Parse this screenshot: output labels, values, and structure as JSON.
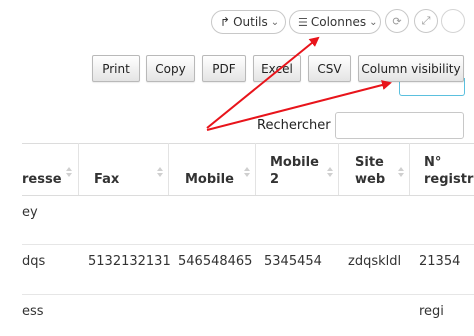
{
  "toolbar": {
    "outils_label": "Outils",
    "outils_caret": "⌄",
    "colonnes_label": "Colonnes",
    "colonnes_caret": "⌄"
  },
  "buttons": {
    "print": "Print",
    "copy": "Copy",
    "pdf": "PDF",
    "excel": "Excel",
    "csv": "CSV",
    "column_visibility": "Column visibility"
  },
  "search": {
    "label": "Rechercher :",
    "value": ""
  },
  "table": {
    "headers": [
      {
        "line1": "resse",
        "line2": ""
      },
      {
        "line1": "Fax",
        "line2": ""
      },
      {
        "line1": "Mobile",
        "line2": ""
      },
      {
        "line1": "Mobile",
        "line2": "2"
      },
      {
        "line1": "Site",
        "line2": "web"
      },
      {
        "line1": "N°",
        "line2": "registre"
      }
    ],
    "rows": [
      [
        "ey",
        "",
        "",
        "",
        "",
        ""
      ],
      [
        "dqs",
        "5132132131",
        "546548465",
        "5345454",
        "zdqskldl",
        "21354"
      ],
      [
        "ess",
        "",
        "",
        "",
        "",
        "regi"
      ]
    ]
  },
  "annotation": {
    "arrow_color": "#e8141b"
  }
}
